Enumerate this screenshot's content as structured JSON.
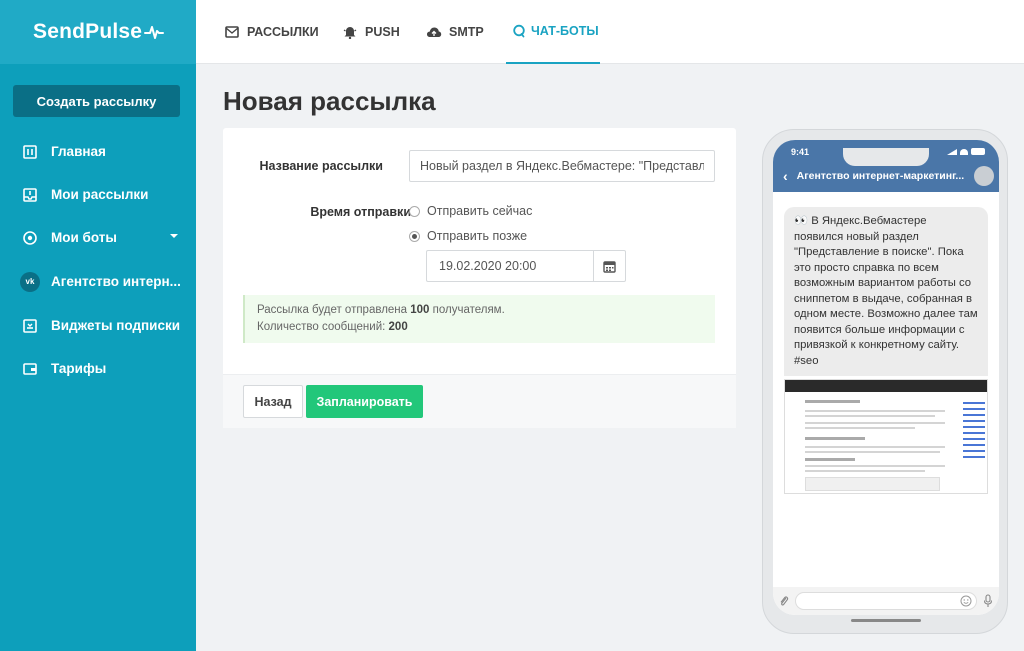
{
  "sidebar": {
    "logo": "SendPulse",
    "create_label": "Создать рассылку",
    "items": [
      {
        "label": "Главная",
        "icon": "home-icon"
      },
      {
        "label": "Мои рассылки",
        "icon": "inbox-icon"
      },
      {
        "label": "Мои боты",
        "icon": "bots-icon"
      },
      {
        "label": "Агентство интерн...",
        "icon": "vk-icon"
      },
      {
        "label": "Виджеты подписки",
        "icon": "widget-icon"
      },
      {
        "label": "Тарифы",
        "icon": "wallet-icon"
      }
    ]
  },
  "topbar": {
    "tabs": [
      {
        "label": "РАССЫЛКИ",
        "icon": "mail-icon"
      },
      {
        "label": "PUSH",
        "icon": "bell-icon"
      },
      {
        "label": "SMTP",
        "icon": "cloud-icon"
      },
      {
        "label": "ЧАТ-БОТЫ",
        "icon": "chat-icon"
      }
    ],
    "active_tab": "ЧАТ-БОТЫ"
  },
  "page": {
    "title": "Новая рассылка",
    "name_label": "Название рассылки",
    "name_value": "Новый раздел в Яндекс.Вебмастере: \"Представл",
    "time_label": "Время отправки",
    "option_now": "Отправить сейчас",
    "option_later": "Отправить позже",
    "selected_option": "later",
    "datetime": "19.02.2020 20:00",
    "notice_line1_prefix": "Рассылка будет отправлена ",
    "notice_recipients": "100",
    "notice_line1_suffix": " получателям.",
    "notice_line2_prefix": "Количество сообщений: ",
    "notice_messages": "200",
    "back_label": "Назад",
    "plan_label": "Запланировать"
  },
  "preview": {
    "status_time": "9:41",
    "chat_title": "Агентство интернет-маркетинг...",
    "message_emoji": "👀",
    "message_text": "В Яндекс.Вебмастере появился новый раздел \"Представление в поиске\". Пока это просто справка по всем возможным вариантом работы со сниппетом в выдаче, собранная в одном месте. Возможно далее там появится больше информации с привязкой к конкретному сайту.",
    "message_tag": "#seo"
  },
  "colors": {
    "sidebar": "#0d9fbb",
    "accent": "#1aa3c2",
    "primary_button": "#22c77a",
    "telegram_header": "#4a76a8"
  }
}
